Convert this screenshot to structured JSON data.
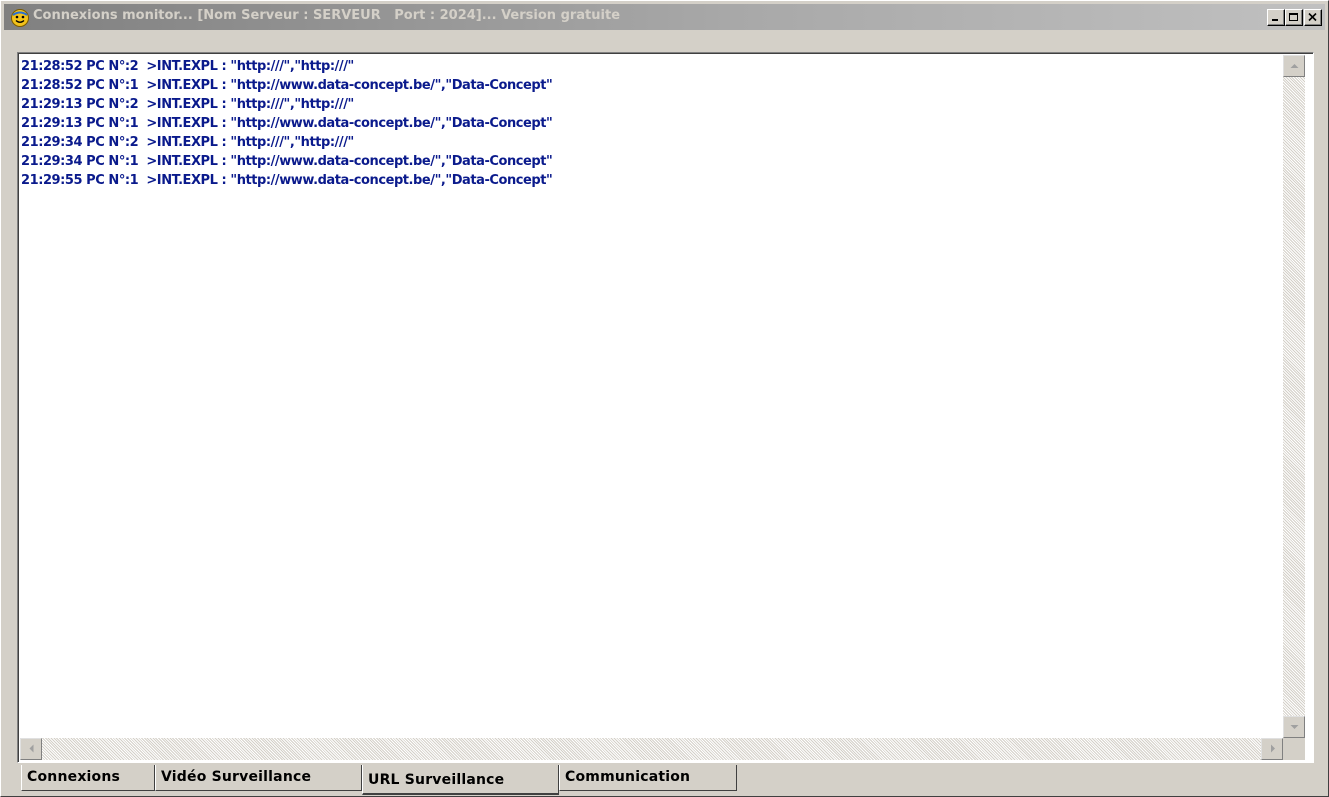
{
  "window": {
    "title": "Connexions monitor... [Nom Serveur : SERVEUR   Port : 2024]... Version gratuite",
    "icon": "smiley-globe-icon",
    "controls": {
      "minimize": "minimize-icon",
      "maximize": "maximize-icon",
      "close": "close-icon"
    }
  },
  "log": {
    "lines": [
      "21:28:52 PC N°:2  >INT.EXPL : \"http:///\",\"http:///\"",
      "21:28:52 PC N°:1  >INT.EXPL : \"http://www.data-concept.be/\",\"Data-Concept\"",
      "21:29:13 PC N°:2  >INT.EXPL : \"http:///\",\"http:///\"",
      "21:29:13 PC N°:1  >INT.EXPL : \"http://www.data-concept.be/\",\"Data-Concept\"",
      "21:29:34 PC N°:2  >INT.EXPL : \"http:///\",\"http:///\"",
      "21:29:34 PC N°:1  >INT.EXPL : \"http://www.data-concept.be/\",\"Data-Concept\"",
      "21:29:55 PC N°:1  >INT.EXPL : \"http://www.data-concept.be/\",\"Data-Concept\""
    ],
    "text_color": "#0a1a8c"
  },
  "tabs": [
    {
      "label": "Connexions",
      "active": false
    },
    {
      "label": "Vidéo Surveillance",
      "active": false
    },
    {
      "label": "URL Surveillance",
      "active": true
    },
    {
      "label": "Communication",
      "active": false
    }
  ]
}
